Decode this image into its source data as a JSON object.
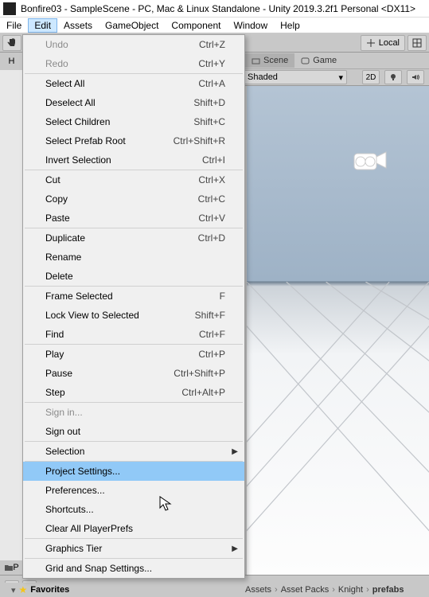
{
  "window_title": "Bonfire03 - SampleScene - PC, Mac & Linux Standalone - Unity 2019.3.2f1 Personal <DX11>",
  "menu": {
    "file": "File",
    "edit": "Edit",
    "assets": "Assets",
    "gameobject": "GameObject",
    "component": "Component",
    "window": "Window",
    "help": "Help"
  },
  "toolbar": {
    "local_label": "Local"
  },
  "hierarchy_label": "H",
  "scene": {
    "tab_scene": "Scene",
    "tab_game": "Game",
    "shading": "Shaded",
    "dim2d": "2D"
  },
  "edit_menu": {
    "items": [
      {
        "label": "Undo",
        "shortcut": "Ctrl+Z",
        "disabled": true
      },
      {
        "label": "Redo",
        "shortcut": "Ctrl+Y",
        "disabled": true
      },
      {
        "sep": true
      },
      {
        "label": "Select All",
        "shortcut": "Ctrl+A"
      },
      {
        "label": "Deselect All",
        "shortcut": "Shift+D"
      },
      {
        "label": "Select Children",
        "shortcut": "Shift+C"
      },
      {
        "label": "Select Prefab Root",
        "shortcut": "Ctrl+Shift+R"
      },
      {
        "label": "Invert Selection",
        "shortcut": "Ctrl+I"
      },
      {
        "sep": true
      },
      {
        "label": "Cut",
        "shortcut": "Ctrl+X"
      },
      {
        "label": "Copy",
        "shortcut": "Ctrl+C"
      },
      {
        "label": "Paste",
        "shortcut": "Ctrl+V"
      },
      {
        "sep": true
      },
      {
        "label": "Duplicate",
        "shortcut": "Ctrl+D"
      },
      {
        "label": "Rename",
        "shortcut": ""
      },
      {
        "label": "Delete",
        "shortcut": ""
      },
      {
        "sep": true
      },
      {
        "label": "Frame Selected",
        "shortcut": "F"
      },
      {
        "label": "Lock View to Selected",
        "shortcut": "Shift+F"
      },
      {
        "label": "Find",
        "shortcut": "Ctrl+F"
      },
      {
        "sep": true
      },
      {
        "label": "Play",
        "shortcut": "Ctrl+P"
      },
      {
        "label": "Pause",
        "shortcut": "Ctrl+Shift+P"
      },
      {
        "label": "Step",
        "shortcut": "Ctrl+Alt+P"
      },
      {
        "sep": true
      },
      {
        "label": "Sign in...",
        "shortcut": "",
        "disabled": true
      },
      {
        "label": "Sign out",
        "shortcut": ""
      },
      {
        "sep": true
      },
      {
        "label": "Selection",
        "shortcut": "",
        "submenu": true
      },
      {
        "sep": true
      },
      {
        "label": "Project Settings...",
        "shortcut": "",
        "highlight": true
      },
      {
        "label": "Preferences...",
        "shortcut": ""
      },
      {
        "label": "Shortcuts...",
        "shortcut": ""
      },
      {
        "label": "Clear All PlayerPrefs",
        "shortcut": ""
      },
      {
        "sep": true
      },
      {
        "label": "Graphics Tier",
        "shortcut": "",
        "submenu": true
      },
      {
        "sep": true
      },
      {
        "label": "Grid and Snap Settings...",
        "shortcut": ""
      }
    ]
  },
  "project_panel": {
    "favorites": "Favorites",
    "p_label": "P"
  },
  "breadcrumb": {
    "a": "Assets",
    "b": "Asset Packs",
    "c": "Knight",
    "d": "prefabs"
  }
}
